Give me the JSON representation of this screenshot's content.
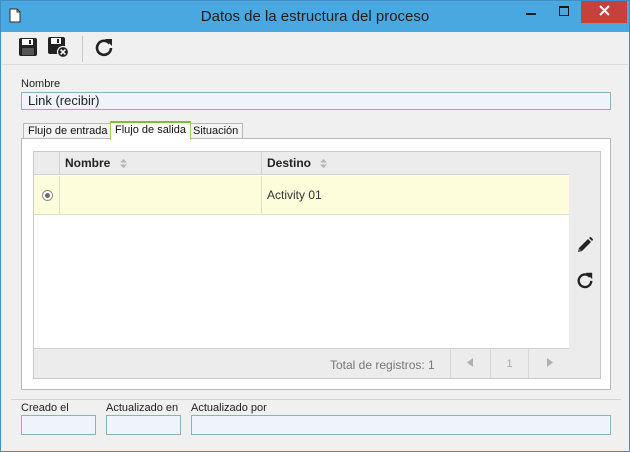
{
  "window": {
    "title": "Datos de la estructura del proceso",
    "icons": {
      "app": "document-icon",
      "minimize": "minimize-icon",
      "maximize": "maximize-icon",
      "close": "close-icon"
    }
  },
  "toolbar": {
    "items": [
      {
        "name": "save",
        "icon": "save-icon"
      },
      {
        "name": "save-and-close",
        "icon": "save-close-icon"
      },
      {
        "name": "refresh",
        "icon": "refresh-icon"
      }
    ]
  },
  "form": {
    "name_label": "Nombre",
    "name_value": "Link (recibir)"
  },
  "tabs": [
    {
      "label": "Flujo de entrada",
      "active": false
    },
    {
      "label": "Flujo de salida",
      "active": true
    },
    {
      "label": "Situación",
      "active": false
    }
  ],
  "grid": {
    "columns": [
      "Nombre",
      "Destino"
    ],
    "rows": [
      {
        "selected": true,
        "nombre": "",
        "destino": "Activity 01"
      }
    ],
    "footer": {
      "total_label": "Total de registros: 1",
      "page": "1"
    },
    "side_tools": [
      {
        "name": "edit",
        "icon": "pencil-icon"
      },
      {
        "name": "refresh",
        "icon": "refresh-icon"
      }
    ]
  },
  "meta": {
    "created_label": "Creado el",
    "created_value": "",
    "updated_label": "Actualizado en",
    "updated_value": "",
    "updated_by_label": "Actualizado por",
    "updated_by_value": ""
  },
  "colors": {
    "titlebar": "#4aa8e0",
    "close_button": "#c7403a",
    "active_tab": "#7cbf3b",
    "selected_row": "#fdfddc"
  }
}
